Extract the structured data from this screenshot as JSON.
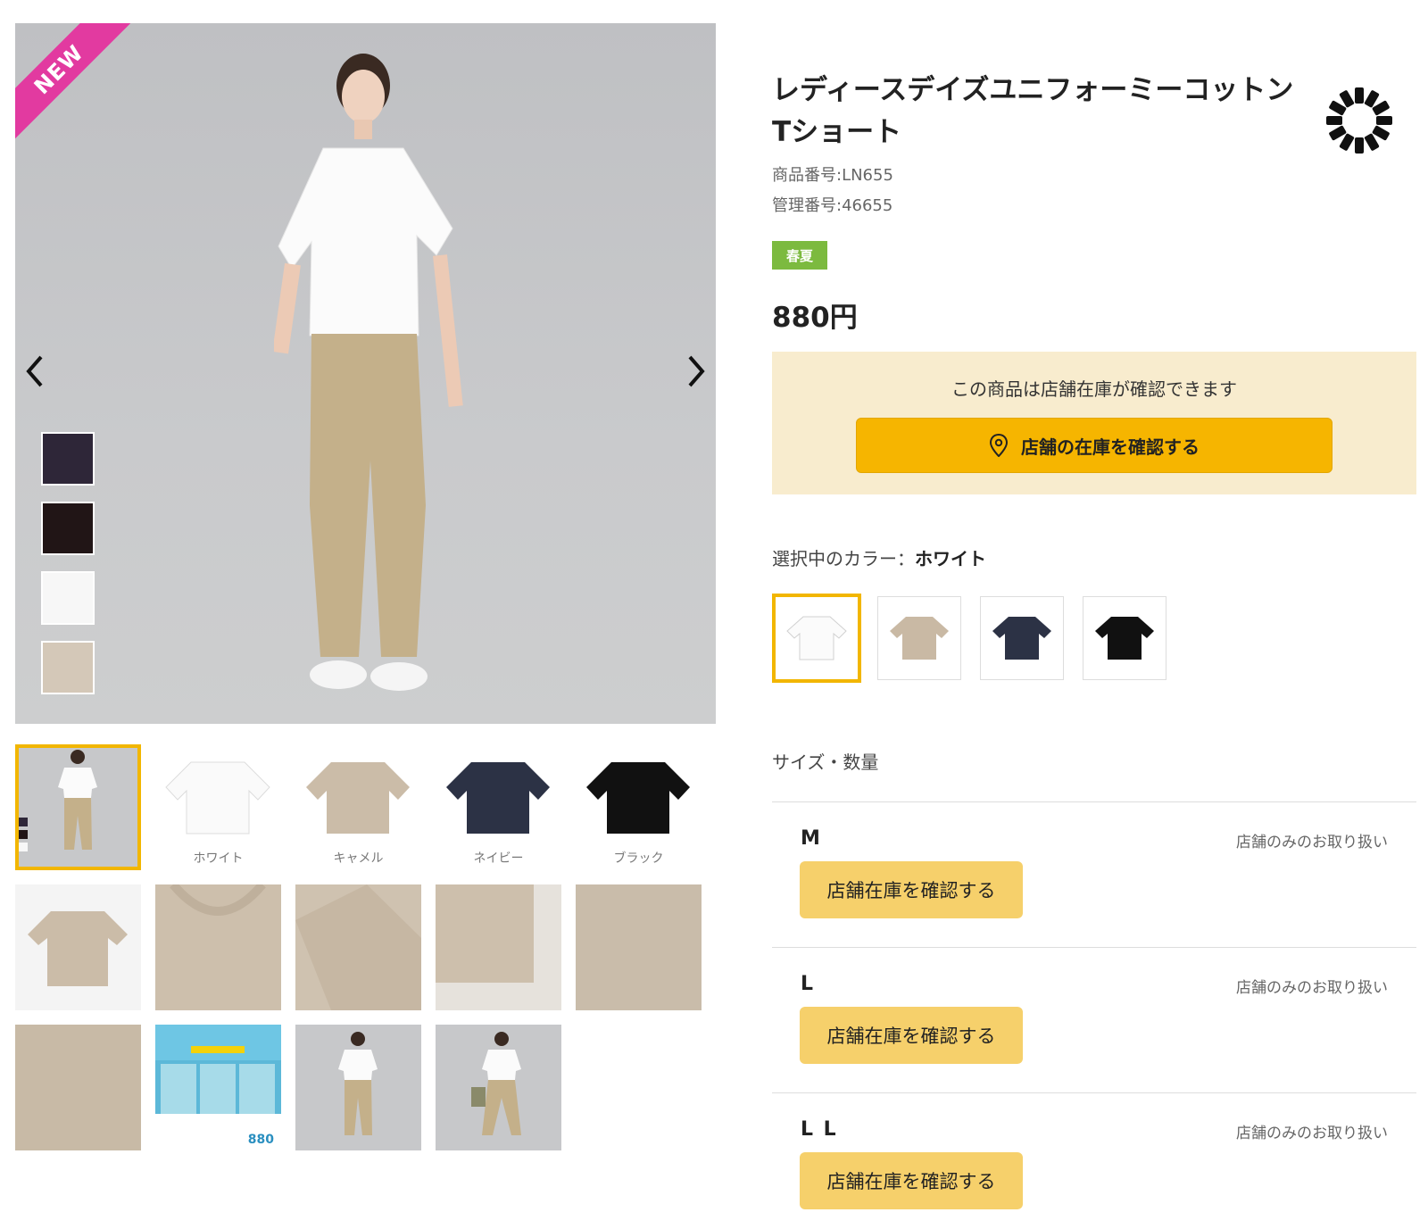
{
  "product": {
    "badge": "NEW",
    "title_line1": "レディースデイズユニフォーミーコットン",
    "title_line2": "Tショート",
    "product_number": "商品番号:LN655",
    "management_number": "管理番号:46655",
    "season": "春夏",
    "price": "880円"
  },
  "stock": {
    "message": "この商品は店舗在庫が確認できます",
    "button_label": "店舗の在庫を確認する"
  },
  "color": {
    "label_prefix": "選択中のカラー：",
    "selected": "ホワイト",
    "options": [
      {
        "name": "white",
        "hex": "#ffffff"
      },
      {
        "name": "camel",
        "hex": "#c9b9a4"
      },
      {
        "name": "navy",
        "hex": "#2c3245"
      },
      {
        "name": "black",
        "hex": "#111111"
      }
    ]
  },
  "thumbnails": {
    "labels": [
      "ホワイト",
      "キャメル",
      "ネイビー",
      "ブラック"
    ]
  },
  "main_swatches": [
    {
      "name": "purple",
      "hex": "#2e2638"
    },
    {
      "name": "brown",
      "hex": "#211516"
    },
    {
      "name": "white",
      "hex": "#f7f7f7"
    },
    {
      "name": "beige",
      "hex": "#d4c8b8"
    }
  ],
  "sizes": {
    "heading": "サイズ・数量",
    "rows": [
      {
        "name": "M",
        "note": "店舗のみのお取り扱い",
        "button": "店舗在庫を確認する"
      },
      {
        "name": "L",
        "note": "店舗のみのお取り扱い",
        "button": "店舗在庫を確認する"
      },
      {
        "name": "L L",
        "note": "店舗のみのお取り扱い",
        "button": "店舗在庫を確認する"
      }
    ]
  },
  "thumb_promo": {
    "price": "880"
  }
}
